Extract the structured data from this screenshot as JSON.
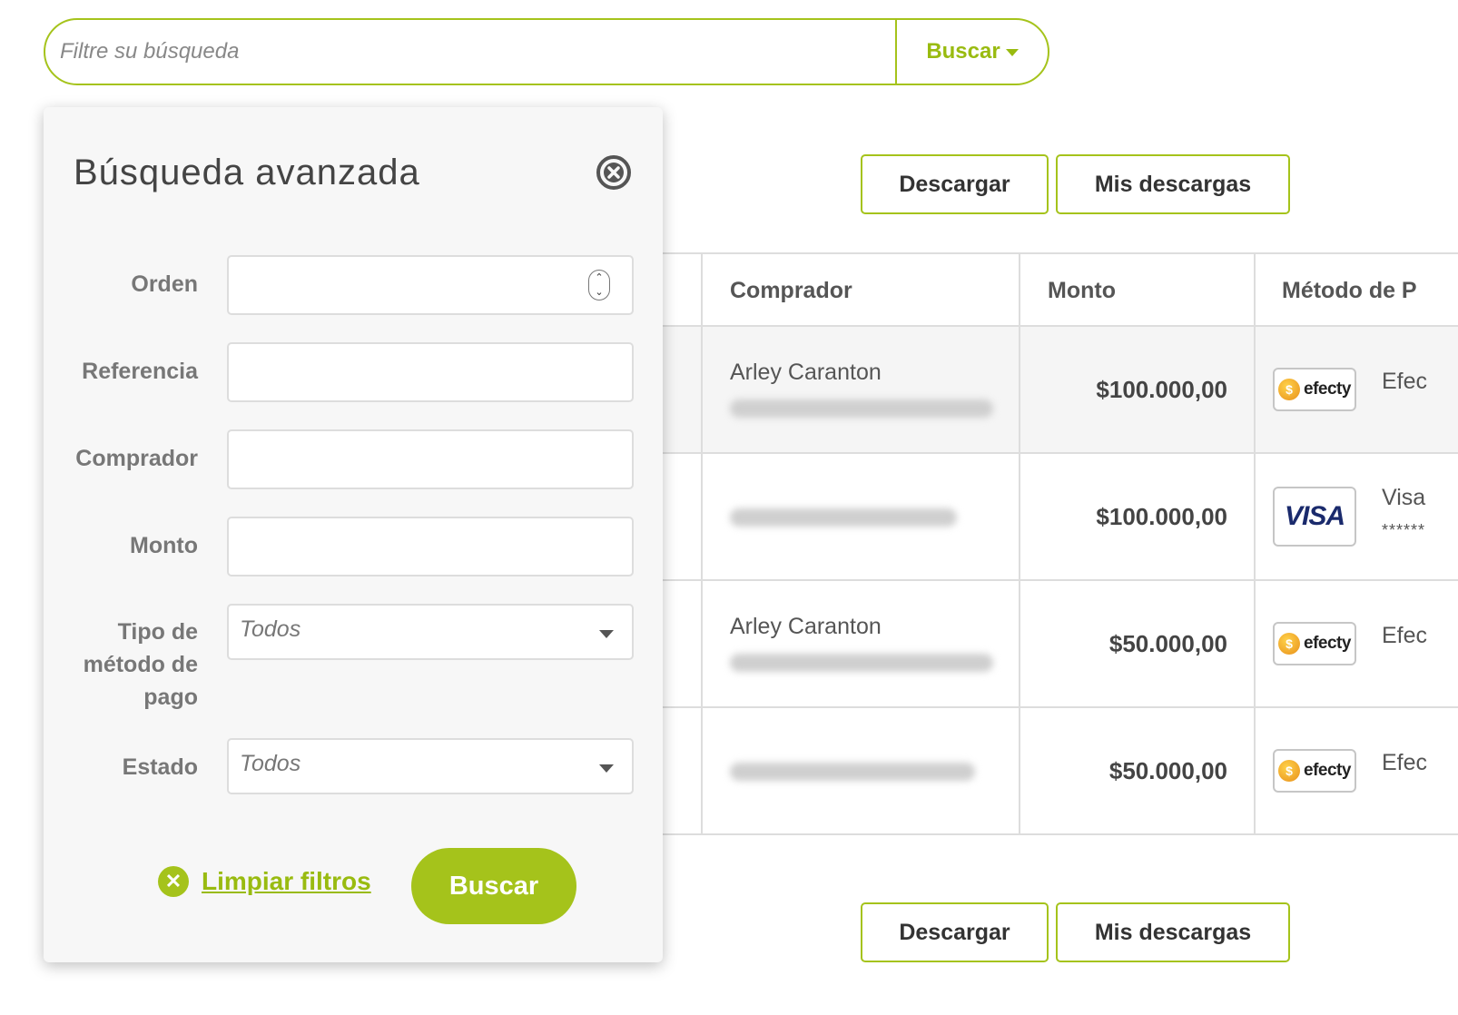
{
  "search": {
    "placeholder": "Filtre su búsqueda",
    "button_label": "Buscar"
  },
  "actions": {
    "download_label": "Descargar",
    "my_downloads_label": "Mis descargas"
  },
  "table": {
    "columns": [
      "Comprador",
      "Monto",
      "Método de P"
    ],
    "rows": [
      {
        "buyer_name": "Arley Caranton",
        "amount": "$100.000,00",
        "method_logo": "efecty",
        "method_name": "Efec",
        "stars": ""
      },
      {
        "buyer_name": "",
        "amount": "$100.000,00",
        "method_logo": "VISA",
        "method_name": "Visa",
        "stars": "******"
      },
      {
        "buyer_name": "Arley Caranton",
        "amount": "$50.000,00",
        "method_logo": "efecty",
        "method_name": "Efec",
        "stars": ""
      },
      {
        "buyer_name": "",
        "amount": "$50.000,00",
        "method_logo": "efecty",
        "method_name": "Efec",
        "stars": ""
      }
    ]
  },
  "advanced_search": {
    "title": "Búsqueda avanzada",
    "fields": {
      "order_label": "Orden",
      "reference_label": "Referencia",
      "buyer_label": "Comprador",
      "amount_label": "Monto",
      "method_type_label_1": "Tipo de",
      "method_type_label_2": "método de",
      "method_type_label_3": "pago",
      "method_type_value": "Todos",
      "status_label": "Estado",
      "status_value": "Todos"
    },
    "clear_label": "Limpiar filtros",
    "submit_label": "Buscar"
  },
  "colors": {
    "accent": "#a5c31b",
    "accent_text": "#99bb10",
    "panel_bg": "#f7f7f7",
    "row_shade": "#f5f5f5"
  }
}
